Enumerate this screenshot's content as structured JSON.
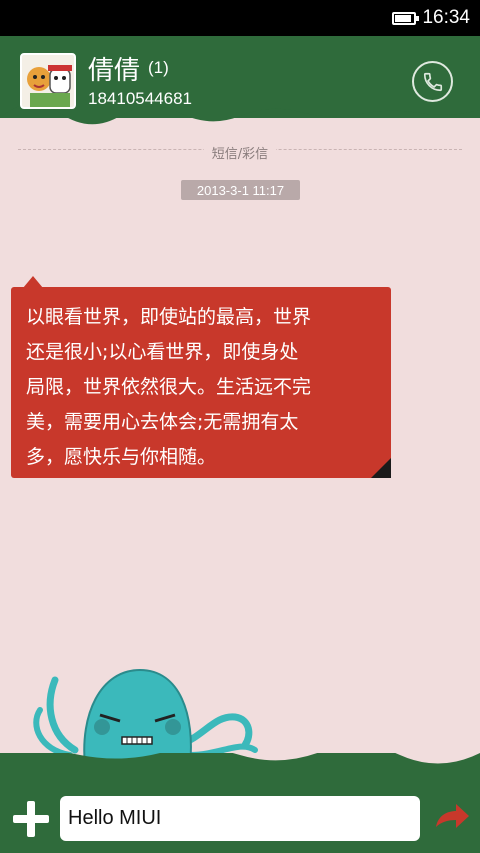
{
  "status_bar": {
    "time": "16:34",
    "battery_icon": "battery-icon"
  },
  "header": {
    "contact_name": "倩倩",
    "unread_count": "(1)",
    "phone_number": "18410544681",
    "call_icon": "phone-icon",
    "background_color": "#2f6b3b"
  },
  "conversation": {
    "section_label": "短信/彩信",
    "timestamp": "2013-3-1 11:17",
    "messages": [
      {
        "text": "以眼看世界，即使站的最高，世界还是很小;以心看世界，即使身处局限，世界依然很大。生活远不完美，需要用心去体会;无需拥有太多，愿快乐与你相随。",
        "lines": [
          "以眼看世界，即使站的最高，世界",
          "还是很小;以心看世界，即使身处",
          "局限，世界依然很大。生活远不完",
          "美，需要用心去体会;无需拥有太",
          "多，愿快乐与你相随。"
        ],
        "color": "#c8382b"
      }
    ]
  },
  "composer": {
    "input_value": "Hello MIUI",
    "add_icon": "plus-icon",
    "send_icon": "send-arrow-icon"
  }
}
